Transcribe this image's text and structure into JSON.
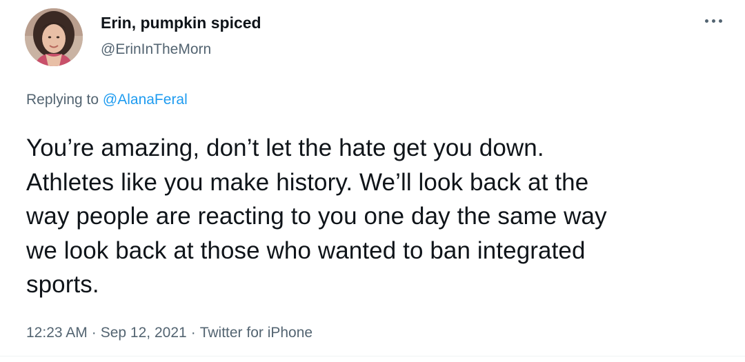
{
  "tweet": {
    "author": {
      "display_name": "Erin, pumpkin spiced",
      "handle": "@ErinInTheMorn"
    },
    "reply": {
      "prefix": "Replying to ",
      "mention": "@AlanaFeral"
    },
    "text_lines": [
      "You’re amazing, don’t let the hate get you down.",
      "Athletes like you make history. We’ll look back at the",
      "way people are reacting to you one day the same way",
      "we look back at those who wanted to ban integrated",
      "sports."
    ],
    "time": "12:23 AM",
    "date": "Sep 12, 2021",
    "source": "Twitter for iPhone",
    "separator": "·",
    "more_icon": "more-dots-icon"
  },
  "colors": {
    "text": "#0f1419",
    "secondary": "#536471",
    "link": "#1d9bf0"
  }
}
